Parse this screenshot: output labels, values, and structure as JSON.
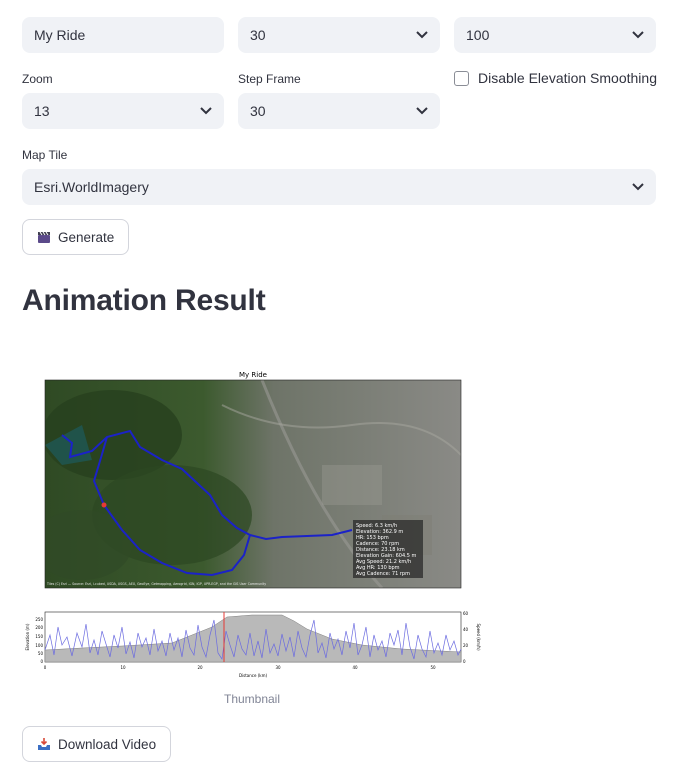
{
  "form": {
    "title_value": "My Ride",
    "fps_value": "30",
    "dpi_value": "100",
    "zoom_label": "Zoom",
    "zoom_value": "13",
    "step_label": "Step Frame",
    "step_value": "30",
    "smoothing_label": "Disable Elevation Smoothing",
    "map_tile_label": "Map Tile",
    "map_tile_value": "Esri.WorldImagery",
    "generate_label": "Generate"
  },
  "result": {
    "heading": "Animation Result",
    "plot_title": "My Ride",
    "stats": [
      "Speed: 6.3 km/h",
      "Elevation: 362.9 m",
      "HR: 153 bpm",
      "Cadence: 70 rpm",
      "Distance: 23.18 km",
      "Elevation Gain: 604.5 m",
      "Avg Speed: 21.2 km/h",
      "Avg HR: 130 bpm",
      "Avg Cadence: 71 rpm"
    ],
    "attribution": "Tiles (C) Esri — Source: Esri, i-cubed, USDA, USGS, AEX, GeoEye, Getmapping, Aerogrid, IGN, IGP, UPR-EGP, and the GIS User Community",
    "elevation_axis_label": "Elevation (m)",
    "speed_axis_label": "Speed (km/h)",
    "distance_axis_label": "Distance (km)",
    "x_ticks": [
      "0",
      "10",
      "20",
      "30",
      "40",
      "50"
    ],
    "y_ticks": [
      "0",
      "50",
      "100",
      "150",
      "200",
      "250"
    ],
    "speed_ticks": [
      "0",
      "20",
      "40",
      "60"
    ],
    "caption": "Thumbnail",
    "download_label": "Download Video"
  },
  "colors": {
    "route": "#1b22c8",
    "speed_line": "#6b6be0",
    "marker": "#e53935",
    "elevation_fill": "#b9b9b9"
  }
}
